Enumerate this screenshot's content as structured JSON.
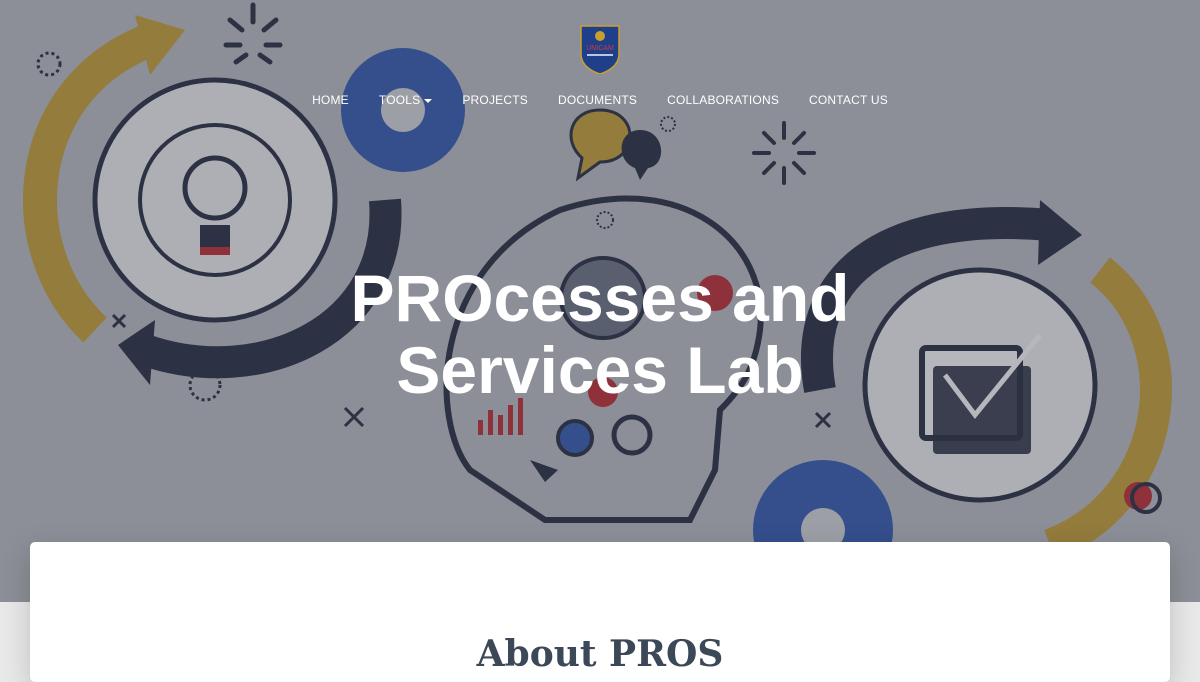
{
  "header": {
    "logo_alt": "UNICAM logo",
    "logo_text": "UNICAM",
    "nav": [
      {
        "label": "HOME"
      },
      {
        "label": "TOOLS",
        "has_dropdown": true
      },
      {
        "label": "PROJECTS"
      },
      {
        "label": "DOCUMENTS"
      },
      {
        "label": "COLLABORATIONS"
      },
      {
        "label": "CONTACT US"
      }
    ]
  },
  "hero": {
    "title_line1": "PROcesses and",
    "title_line2": "Services Lab"
  },
  "section": {
    "heading": "About PROS"
  },
  "colors": {
    "overlay": "#3c4252",
    "gold": "#c8a030",
    "navy": "#23283a",
    "blue": "#2f57b0",
    "red": "#c0282e"
  }
}
